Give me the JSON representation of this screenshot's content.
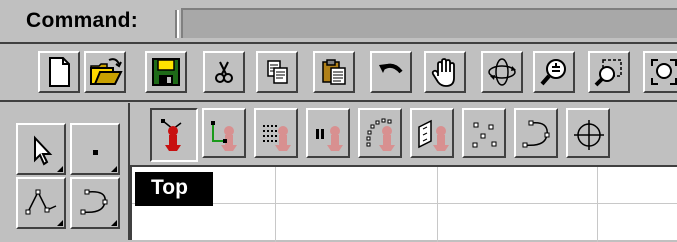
{
  "command_bar": {
    "label": "Command:",
    "input_value": ""
  },
  "main_toolbar": {
    "buttons": [
      {
        "name": "new-file-icon"
      },
      {
        "name": "open-folder-icon"
      },
      {
        "name": "save-disk-icon"
      },
      {
        "name": "cut-scissors-icon"
      },
      {
        "name": "copy-icon"
      },
      {
        "name": "paste-icon"
      },
      {
        "name": "undo-arrow-icon"
      },
      {
        "name": "pan-hand-icon"
      },
      {
        "name": "rotate-view-icon"
      },
      {
        "name": "zoom-in-out-icon"
      },
      {
        "name": "zoom-window-icon"
      },
      {
        "name": "zoom-extents-icon"
      }
    ]
  },
  "left_palette": {
    "tools": [
      {
        "name": "select-arrow-icon"
      },
      {
        "name": "point-icon"
      },
      {
        "name": "polyline-icon"
      },
      {
        "name": "curve-icon"
      }
    ]
  },
  "sub_toolbar": {
    "buttons": [
      {
        "name": "point-cloud-robot-icon",
        "pressed": true
      },
      {
        "name": "point-axes-icon"
      },
      {
        "name": "point-grid-icon"
      },
      {
        "name": "pause-point-icon"
      },
      {
        "name": "curve-points-icon"
      },
      {
        "name": "surface-points-icon"
      },
      {
        "name": "scatter-points-icon"
      },
      {
        "name": "curve-control-points-icon"
      },
      {
        "name": "target-crosshair-icon"
      }
    ]
  },
  "viewport": {
    "title": "Top"
  },
  "colors": {
    "face": "#c0c0c0",
    "highlight": "#ffffff",
    "shadow": "#404040",
    "robot_red": "#c81010",
    "robot_faded": "#d89090",
    "view_tab": "#000000"
  }
}
